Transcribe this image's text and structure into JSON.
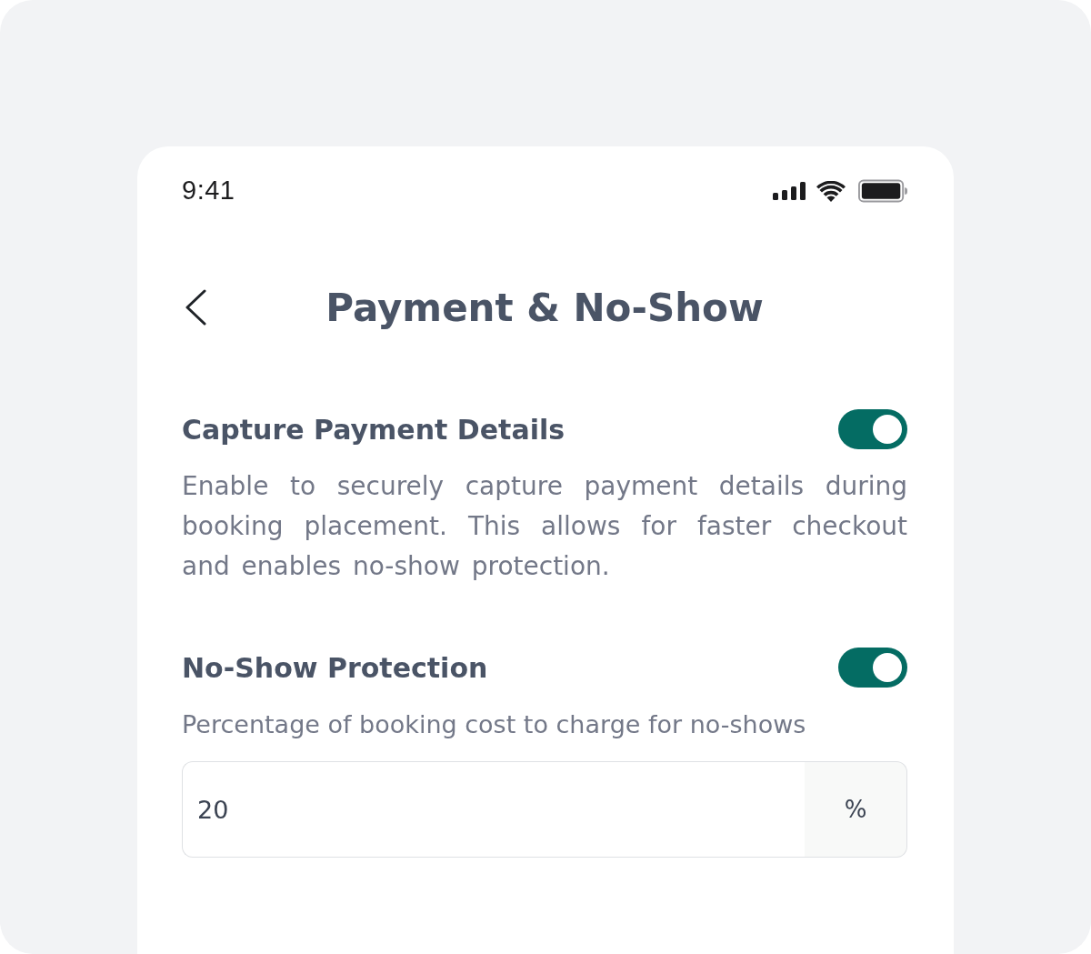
{
  "status_bar": {
    "time": "9:41"
  },
  "header": {
    "title": "Payment & No-Show"
  },
  "settings": [
    {
      "title": "Capture Payment Details",
      "on": true,
      "description": "Enable to securely capture payment details during booking placement. This allows for faster checkout and enables no-show protection."
    },
    {
      "title": "No-Show Protection",
      "on": true,
      "description": "Percentage of booking cost to charge for no-shows",
      "input": {
        "value": "20",
        "suffix": "%"
      }
    }
  ]
}
